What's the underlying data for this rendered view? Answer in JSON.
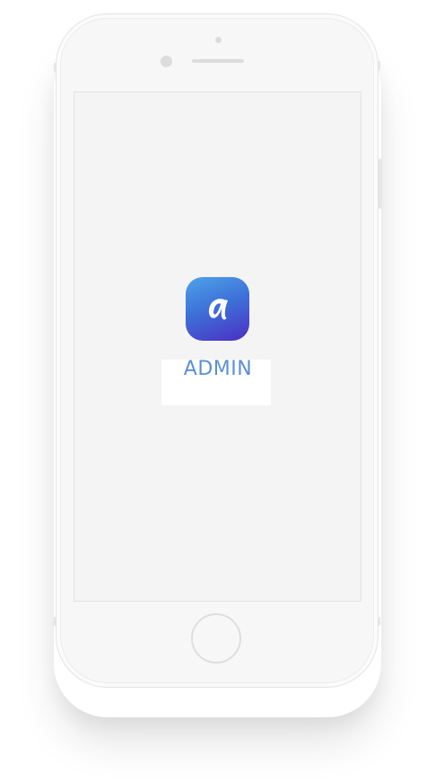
{
  "device": {
    "model": "phone",
    "color": "#f7f7f7"
  },
  "app": {
    "icon_name": "letter-a-logo-icon",
    "title": "ADMIN",
    "brand_colors": {
      "icon_gradient_start": "#4fa2ea",
      "icon_gradient_end": "#4b2fc4",
      "title_color": "#5b8fd6"
    }
  }
}
